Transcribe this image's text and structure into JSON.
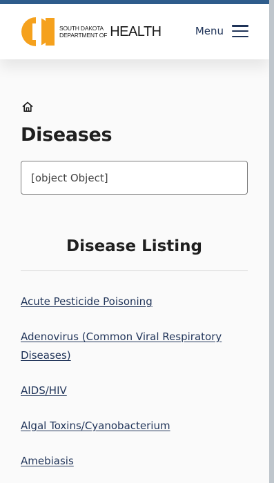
{
  "header": {
    "logo_sub_line1": "SOUTH DAKOTA",
    "logo_sub_line2": "DEPARTMENT OF",
    "logo_health": "HEALTH",
    "menu_label": "Menu"
  },
  "colors": {
    "top_stripe": "#2f5d8c",
    "brand_orange": "#f5a11d",
    "link": "#1f3358"
  },
  "breadcrumb": {
    "home_icon": "home-icon"
  },
  "page": {
    "title": "Diseases"
  },
  "search": {
    "value": "[object Object]"
  },
  "listing": {
    "title": "Disease Listing",
    "items": [
      "Acute Pesticide Poisoning",
      "Adenovirus (Common Viral Respiratory Diseases)",
      "AIDS/HIV",
      "Algal Toxins/Cyanobacterium",
      "Amebiasis"
    ]
  }
}
